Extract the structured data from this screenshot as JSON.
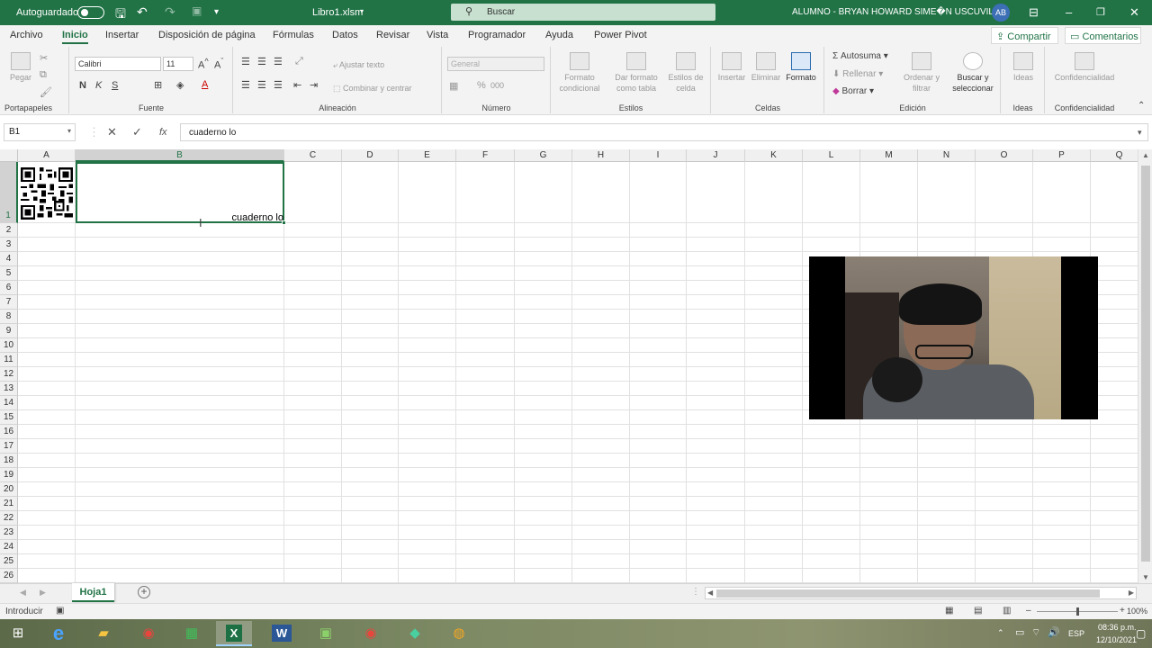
{
  "title_bar": {
    "autosave_label": "Autoguardado",
    "file_name": "Libro1.xlsm",
    "search_placeholder": "Buscar",
    "user_name": "ALUMNO - BRYAN HOWARD SIME�N USCUVILCA",
    "user_initials": "AB"
  },
  "tabs": [
    "Archivo",
    "Inicio",
    "Insertar",
    "Disposición de página",
    "Fórmulas",
    "Datos",
    "Revisar",
    "Vista",
    "Programador",
    "Ayuda",
    "Power Pivot"
  ],
  "active_tab": "Inicio",
  "share_label": "Compartir",
  "comments_label": "Comentarios",
  "ribbon": {
    "portapapeles": {
      "paste": "Pegar",
      "label": "Portapapeles"
    },
    "fuente": {
      "font_name": "Calibri",
      "font_size": "11",
      "bold": "N",
      "italic": "K",
      "underline": "S",
      "label": "Fuente"
    },
    "alineacion": {
      "wrap": "Ajustar texto",
      "merge": "Combinar y centrar",
      "label": "Alineación"
    },
    "numero": {
      "format": "General",
      "percent": "%",
      "thousands": "000",
      "label": "Número"
    },
    "estilos": {
      "conditional": [
        "Formato",
        "condicional"
      ],
      "as_table": [
        "Dar formato",
        "como tabla"
      ],
      "cell_styles": [
        "Estilos de",
        "celda"
      ],
      "label": "Estilos"
    },
    "celdas": {
      "insert": "Insertar",
      "delete": "Eliminar",
      "format": "Formato",
      "label": "Celdas"
    },
    "edicion": {
      "autosum": "Autosuma",
      "fill": "Rellenar",
      "clear": "Borrar",
      "sort": [
        "Ordenar y",
        "filtrar"
      ],
      "find": [
        "Buscar y",
        "seleccionar"
      ],
      "label": "Edición"
    },
    "ideas": {
      "ideas": "Ideas",
      "label": "Ideas"
    },
    "confidencialidad": {
      "sensitivity": "Confidencialidad",
      "label": "Confidencialidad"
    }
  },
  "formula_bar": {
    "name_box": "B1",
    "fx": "fx",
    "content": "cuaderno lo"
  },
  "columns": [
    "A",
    "B",
    "C",
    "D",
    "E",
    "F",
    "G",
    "H",
    "I",
    "J",
    "K",
    "L",
    "M",
    "N",
    "O",
    "P",
    "Q"
  ],
  "rows": [
    "1",
    "2",
    "3",
    "4",
    "5",
    "6",
    "7",
    "8",
    "9",
    "10",
    "11",
    "12",
    "13",
    "14",
    "15",
    "16",
    "17",
    "18",
    "19",
    "20",
    "21",
    "22",
    "23",
    "24",
    "25",
    "26"
  ],
  "cells": {
    "B1": "cuaderno lo"
  },
  "selected_cell": "B1",
  "sheet_tab": "Hoja1",
  "status": {
    "mode": "Introducir",
    "zoom": "100%"
  },
  "taskbar": {
    "lang": "ESP",
    "time": "08:36 p.m.",
    "date": "12/10/2021"
  },
  "colors": {
    "accent": "#217346"
  }
}
